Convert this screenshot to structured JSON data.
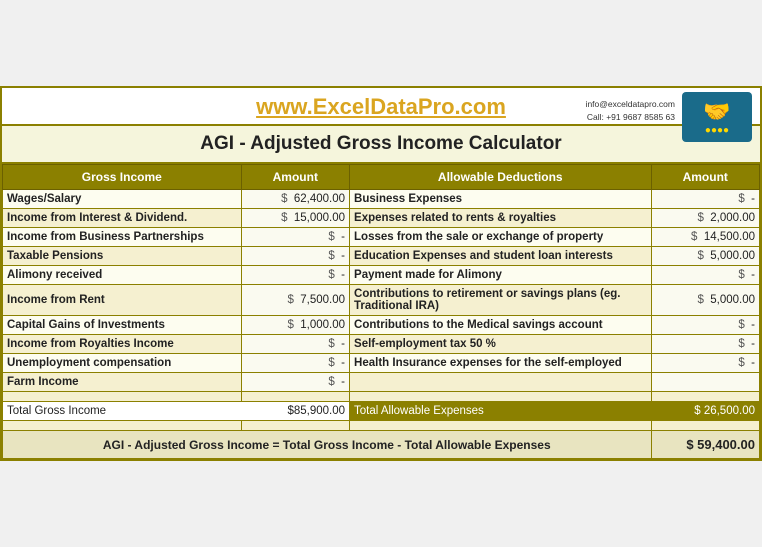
{
  "header": {
    "site_url": "www.ExcelDataPro.com",
    "contact_email": "info@exceldatapro.com",
    "contact_call": "Call: +91 9687 8585 63",
    "main_title": "AGI - Adjusted Gross Income Calculator",
    "logo_icon": "🤝"
  },
  "table": {
    "col1_header": "Gross Income",
    "col2_header": "Amount",
    "col3_header": "Allowable Deductions",
    "col4_header": "Amount",
    "rows": [
      {
        "income": "Wages/Salary",
        "income_dollar": "$",
        "income_amount": "62,400.00",
        "deduction": "Business Expenses",
        "deduction_dollar": "$",
        "deduction_amount": "-"
      },
      {
        "income": "Income from Interest & Dividend.",
        "income_dollar": "$",
        "income_amount": "15,000.00",
        "deduction": "Expenses related to rents & royalties",
        "deduction_dollar": "$",
        "deduction_amount": "2,000.00"
      },
      {
        "income": "Income from Business Partnerships",
        "income_dollar": "$",
        "income_amount": "-",
        "deduction": "Losses from the sale or exchange of property",
        "deduction_dollar": "$",
        "deduction_amount": "14,500.00"
      },
      {
        "income": "Taxable Pensions",
        "income_dollar": "$",
        "income_amount": "-",
        "deduction": "Education Expenses and student loan interests",
        "deduction_dollar": "$",
        "deduction_amount": "5,000.00"
      },
      {
        "income": "Alimony received",
        "income_dollar": "$",
        "income_amount": "-",
        "deduction": "Payment made for Alimony",
        "deduction_dollar": "$",
        "deduction_amount": "-"
      },
      {
        "income": "Income from Rent",
        "income_dollar": "$",
        "income_amount": "7,500.00",
        "deduction": "Contributions to retirement or savings plans (eg. Traditional IRA)",
        "deduction_dollar": "$",
        "deduction_amount": "5,000.00"
      },
      {
        "income": "Capital Gains of Investments",
        "income_dollar": "$",
        "income_amount": "1,000.00",
        "deduction": "Contributions to the Medical savings account",
        "deduction_dollar": "$",
        "deduction_amount": "-"
      },
      {
        "income": "Income from Royalties Income",
        "income_dollar": "$",
        "income_amount": "-",
        "deduction": "Self-employment tax 50 %",
        "deduction_dollar": "$",
        "deduction_amount": "-"
      },
      {
        "income": "Unemployment compensation",
        "income_dollar": "$",
        "income_amount": "-",
        "deduction": "Health Insurance expenses for the self-employed",
        "deduction_dollar": "$",
        "deduction_amount": "-"
      },
      {
        "income": "Farm Income",
        "income_dollar": "$",
        "income_amount": "-",
        "deduction": "",
        "deduction_dollar": "",
        "deduction_amount": ""
      }
    ],
    "total_label_income": "Total Gross Income",
    "total_amount_income": "$85,900.00",
    "total_label_deductions": "Total Allowable Expenses",
    "total_amount_deductions": "$ 26,500.00",
    "agi_label": "AGI - Adjusted Gross Income = Total Gross Income - Total Allowable Expenses",
    "agi_value": "$ 59,400.00"
  }
}
